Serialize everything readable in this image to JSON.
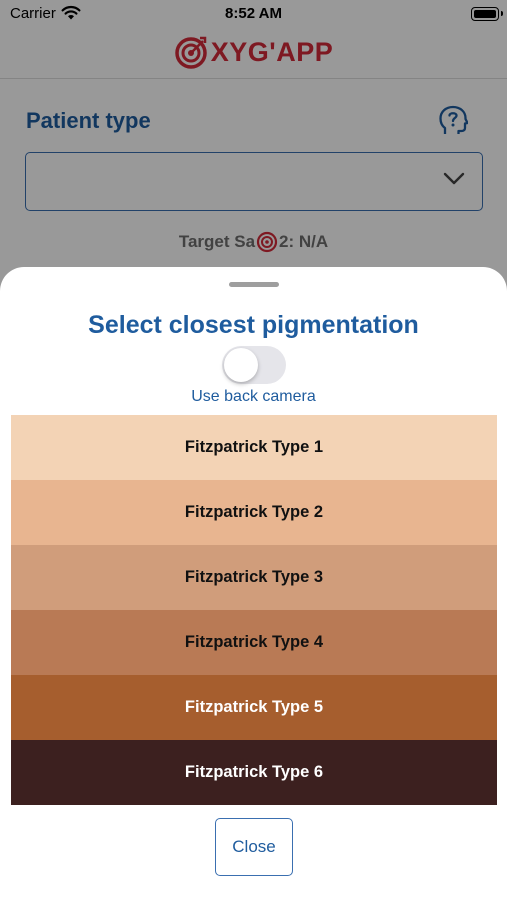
{
  "status_bar": {
    "carrier": "Carrier",
    "time": "8:52 AM"
  },
  "header": {
    "logo_text": "XYG'APP",
    "logo_icon": "target-icon",
    "brand_color": "#d22a3a"
  },
  "main": {
    "patient_type_label": "Patient type",
    "patient_type_value": "",
    "help_icon": "question-head-icon",
    "target_prefix": "Target Sa",
    "target_suffix": "2: N/A"
  },
  "sheet": {
    "title": "Select closest pigmentation",
    "toggle_on": false,
    "camera_label": "Use back camera",
    "types": [
      {
        "label": "Fitzpatrick Type 1",
        "color": "#f3d3b5",
        "text_color": "#111111"
      },
      {
        "label": "Fitzpatrick Type 2",
        "color": "#e8b590",
        "text_color": "#111111"
      },
      {
        "label": "Fitzpatrick Type 3",
        "color": "#d09d7b",
        "text_color": "#111111"
      },
      {
        "label": "Fitzpatrick Type 4",
        "color": "#b97a55",
        "text_color": "#111111"
      },
      {
        "label": "Fitzpatrick Type 5",
        "color": "#a65e2e",
        "text_color": "#ffffff"
      },
      {
        "label": "Fitzpatrick Type 6",
        "color": "#3c201f",
        "text_color": "#ffffff"
      }
    ],
    "close_label": "Close"
  }
}
